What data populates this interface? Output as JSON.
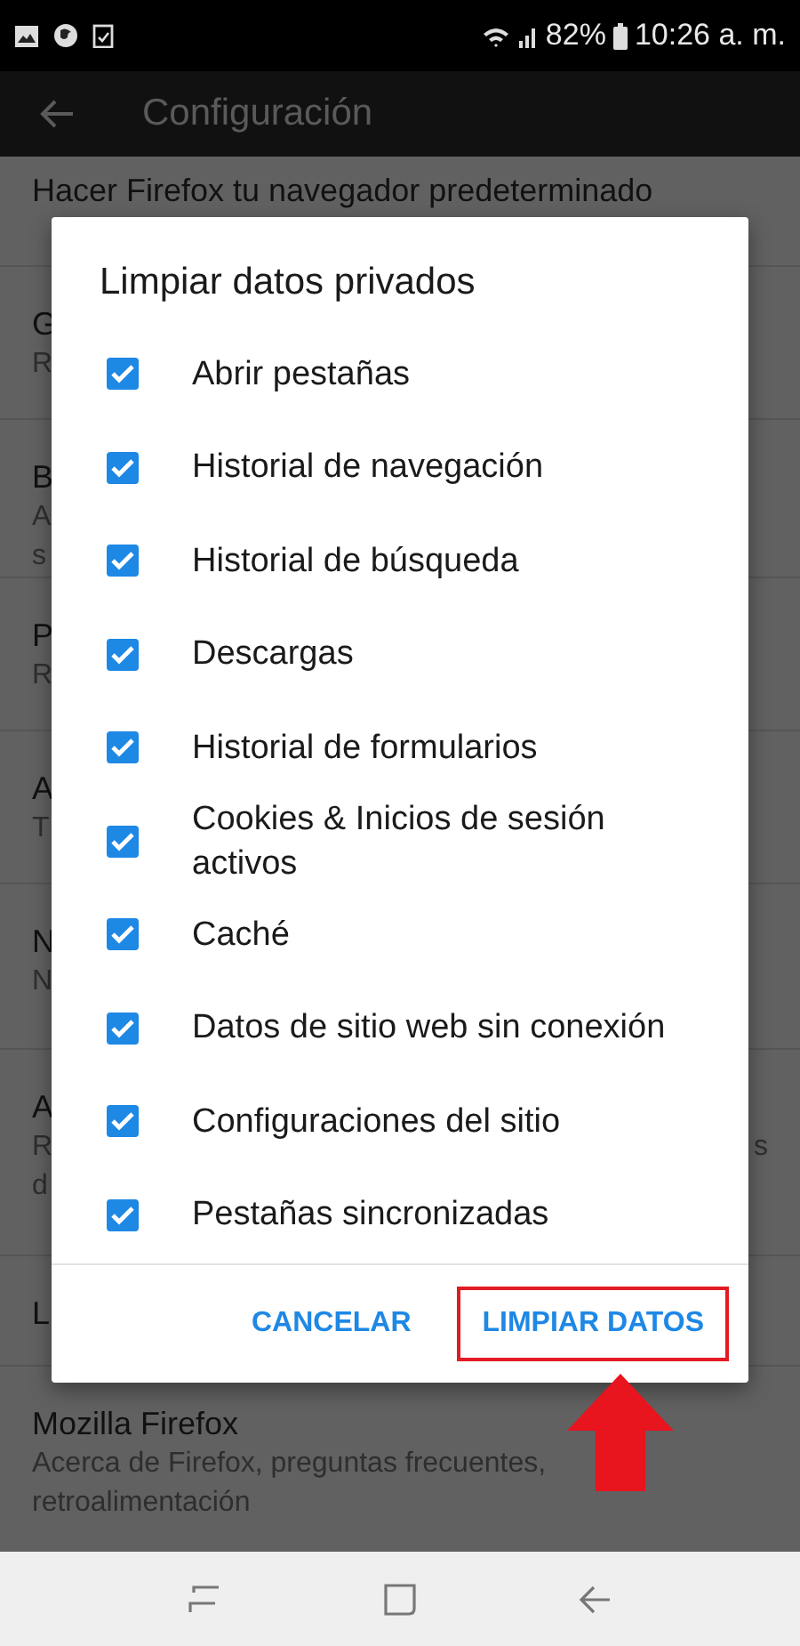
{
  "status_bar": {
    "battery": "82%",
    "time": "10:26 a. m."
  },
  "toolbar": {
    "title": "Configuración"
  },
  "settings": [
    {
      "title": "Hacer Firefox tu navegador predeterminado"
    },
    {
      "title": "G",
      "lines": [
        "R"
      ]
    },
    {
      "title": "B",
      "lines": [
        "A",
        "s"
      ]
    },
    {
      "title": "P",
      "lines": [
        "R"
      ]
    },
    {
      "title": "A",
      "lines": [
        "T"
      ]
    },
    {
      "title": "N",
      "lines": [
        "N"
      ]
    },
    {
      "title": "A",
      "lines": [
        "R",
        "d"
      ],
      "tail": "s"
    },
    {
      "title": "L"
    },
    {
      "title": "Mozilla Firefox",
      "lines": [
        "Acerca de Firefox, preguntas frecuentes,",
        "retroalimentación"
      ]
    }
  ],
  "dialog": {
    "title": "Limpiar datos privados",
    "options": [
      {
        "label": "Abrir pestañas",
        "checked": true
      },
      {
        "label": "Historial de navegación",
        "checked": true
      },
      {
        "label": "Historial de búsqueda",
        "checked": true
      },
      {
        "label": "Descargas",
        "checked": true
      },
      {
        "label": "Historial de formularios",
        "checked": true
      },
      {
        "label": "Cookies & Inicios de sesión activos",
        "checked": true
      },
      {
        "label": "Caché",
        "checked": true
      },
      {
        "label": "Datos de sitio web sin conexión",
        "checked": true
      },
      {
        "label": "Configuraciones del sitio",
        "checked": true
      },
      {
        "label": "Pestañas sincronizadas",
        "checked": true
      }
    ],
    "buttons": [
      {
        "label": "CANCELAR",
        "highlighted": false
      },
      {
        "label": "LIMPIAR DATOS",
        "highlighted": true
      }
    ]
  }
}
